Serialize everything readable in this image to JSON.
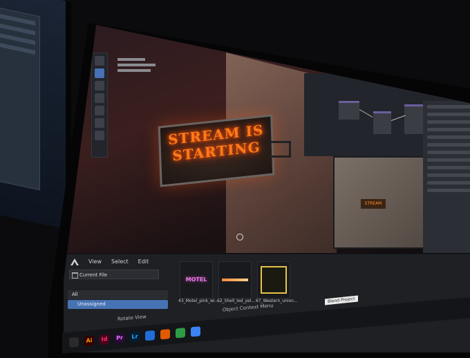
{
  "viewport": {
    "sign_line_1": "STREAM IS",
    "sign_line_2": "STARTING",
    "mini_sign": "STREAM"
  },
  "asset_browser": {
    "menu": [
      "View",
      "Select",
      "Edit"
    ],
    "library": "Current File",
    "categories": {
      "all": "All",
      "unassigned": "Unassigned"
    },
    "assets": [
      {
        "label": "43_Motel_pink_wi...",
        "thumb_text": "MOTEL"
      },
      {
        "label": "62_Shell_led_yel..."
      },
      {
        "label": "67_Western_union..."
      }
    ]
  },
  "status": {
    "left": "Rotate View",
    "middle": "Object Context Menu"
  },
  "tooltip": "Blend Project",
  "taskbar": {
    "icons": [
      "Ai",
      "Id",
      "Pr",
      "Lr"
    ]
  },
  "colors": {
    "accent": "#4772b3",
    "neon": "#ff7a1a"
  }
}
